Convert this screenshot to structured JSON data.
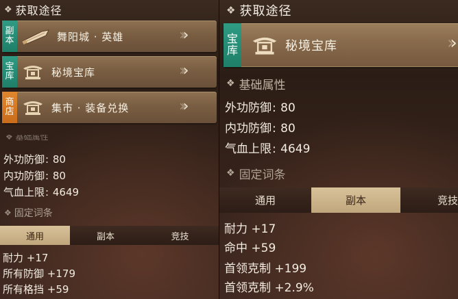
{
  "left": {
    "header": {
      "title": "获取途径"
    },
    "sources": [
      {
        "badge": [
          "副",
          "本"
        ],
        "label": "舞阳城 · 英雄",
        "icon": "sword-icon"
      },
      {
        "badge": [
          "宝",
          "库"
        ],
        "label": "秘境宝库",
        "icon": "treasure-hall-icon"
      },
      {
        "badge": [
          "商",
          "店"
        ],
        "label": "集市 · 装备兑换",
        "icon": "market-icon"
      }
    ],
    "partial_heading": "基础属性",
    "base_stats": [
      {
        "name": "外功防御",
        "value": "80"
      },
      {
        "name": "内功防御",
        "value": "80"
      },
      {
        "name": "气血上限",
        "value": "4649"
      }
    ],
    "fixed_heading": "固定词条",
    "tabs": [
      "通用",
      "副本",
      "竞技"
    ],
    "active_tab": 0,
    "entries": [
      {
        "name": "耐力",
        "value": "+17"
      },
      {
        "name": "所有防御",
        "value": "+179"
      },
      {
        "name": "所有格挡",
        "value": "+59"
      }
    ]
  },
  "right": {
    "header": {
      "title": "获取途径"
    },
    "source": {
      "badge": [
        "宝",
        "库"
      ],
      "label": "秘境宝库",
      "icon": "treasure-hall-icon"
    },
    "base_heading": "基础属性",
    "base_stats": [
      {
        "name": "外功防御",
        "value": "80"
      },
      {
        "name": "内功防御",
        "value": "80"
      },
      {
        "name": "气血上限",
        "value": "4649"
      }
    ],
    "fixed_heading": "固定词条",
    "tabs": [
      "通用",
      "副本",
      "竞技"
    ],
    "active_tab": 1,
    "entries": [
      {
        "name": "耐力",
        "value": "+17"
      },
      {
        "name": "命中",
        "value": "+59"
      },
      {
        "name": "首领克制",
        "value": "+199"
      },
      {
        "name": "首领克制",
        "value": "+2.9%"
      }
    ]
  },
  "colors": {
    "badge_green": "#2f9b82",
    "badge_orange": "#e0862f",
    "active_tab": "#d8c29a",
    "card": "#7a5e43"
  }
}
